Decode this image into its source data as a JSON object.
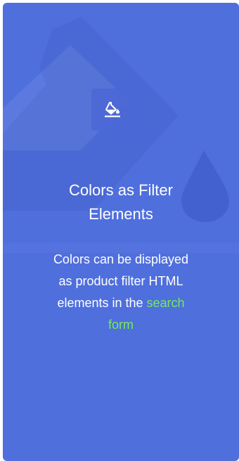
{
  "card": {
    "background_color": "#4f6fdd",
    "icon": "paint-bucket-icon",
    "background_watermark": "paint-bucket-watermark-icon",
    "title_lines": [
      "Colors as Filter",
      "Elements"
    ],
    "description_line1": "Colors can be displayed",
    "description_line2": "as product filter HTML",
    "description_line3_text": "elements in the",
    "link_text_line1": "search",
    "link_text_line2": "form",
    "link_color": "#74ea5a"
  }
}
